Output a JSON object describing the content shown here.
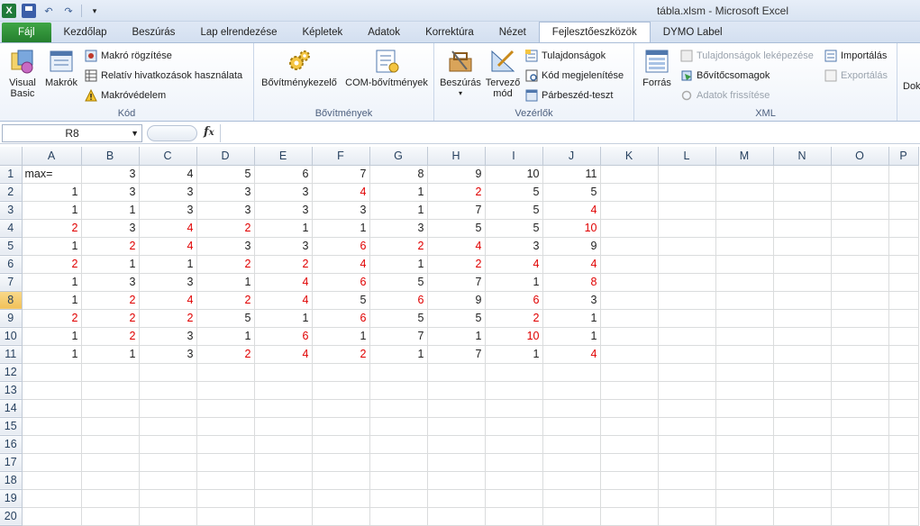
{
  "window": {
    "title": "tábla.xlsm  -  Microsoft Excel"
  },
  "tabs": [
    "Fájl",
    "Kezdőlap",
    "Beszúrás",
    "Lap elrendezése",
    "Képletek",
    "Adatok",
    "Korrektúra",
    "Nézet",
    "Fejlesztőeszközök",
    "DYMO Label"
  ],
  "active_tab": "Fejlesztőeszközök",
  "ribbon": {
    "kod": {
      "label": "Kód",
      "visual_basic": "Visual\nBasic",
      "makrok": "Makrók",
      "makro_rogzitese": "Makró rögzítése",
      "relativ": "Relatív hivatkozások használata",
      "makrovedelem": "Makróvédelem"
    },
    "bovitmenyek": {
      "label": "Bővítmények",
      "bovitmenykezelo": "Bővítménykezelő",
      "com": "COM-bővítmények"
    },
    "vezerlok": {
      "label": "Vezérlők",
      "beszuras": "Beszúrás",
      "tervezo": "Tervező\nmód",
      "tulajdonsagok": "Tulajdonságok",
      "kod_megjelenitese": "Kód megjelenítése",
      "parbeszed": "Párbeszéd-teszt"
    },
    "xml": {
      "label": "XML",
      "forras": "Forrás",
      "tulajdonsagok_lekepezese": "Tulajdonságok leképezése",
      "bovitocsomagok": "Bővítőcsomagok",
      "adatok_frissitese": "Adatok frissítése",
      "importalas": "Importálás",
      "exportalas": "Exportálás"
    },
    "extra": {
      "label": "Dok"
    }
  },
  "formula_bar": {
    "name_box": "R8",
    "fx": "fx",
    "formula": ""
  },
  "columns": [
    "A",
    "B",
    "C",
    "D",
    "E",
    "F",
    "G",
    "H",
    "I",
    "J",
    "K",
    "L",
    "M",
    "N",
    "O",
    "P"
  ],
  "selected_row": 8,
  "rows": [
    {
      "n": "1",
      "cells": [
        "max=",
        "3",
        "4",
        "5",
        "6",
        "7",
        "8",
        "9",
        "10",
        "11"
      ],
      "red": []
    },
    {
      "n": "2",
      "cells": [
        "1",
        "3",
        "3",
        "3",
        "3",
        "4",
        "1",
        "2",
        "5",
        "5"
      ],
      "red": [
        5,
        7
      ]
    },
    {
      "n": "3",
      "cells": [
        "1",
        "1",
        "3",
        "3",
        "3",
        "3",
        "1",
        "7",
        "5",
        "4"
      ],
      "red": [
        9
      ]
    },
    {
      "n": "4",
      "cells": [
        "2",
        "3",
        "4",
        "2",
        "1",
        "1",
        "3",
        "5",
        "5",
        "10"
      ],
      "red": [
        0,
        2,
        3,
        9
      ]
    },
    {
      "n": "5",
      "cells": [
        "1",
        "2",
        "4",
        "3",
        "3",
        "6",
        "2",
        "4",
        "3",
        "9"
      ],
      "red": [
        1,
        2,
        5,
        6,
        7
      ]
    },
    {
      "n": "6",
      "cells": [
        "2",
        "1",
        "1",
        "2",
        "2",
        "4",
        "1",
        "2",
        "4",
        "4"
      ],
      "red": [
        0,
        3,
        4,
        5,
        7,
        8,
        9
      ]
    },
    {
      "n": "7",
      "cells": [
        "1",
        "3",
        "3",
        "1",
        "4",
        "6",
        "5",
        "7",
        "1",
        "8"
      ],
      "red": [
        4,
        5,
        9
      ]
    },
    {
      "n": "8",
      "cells": [
        "1",
        "2",
        "4",
        "2",
        "4",
        "5",
        "6",
        "9",
        "6",
        "3"
      ],
      "red": [
        1,
        2,
        3,
        4,
        6,
        8
      ]
    },
    {
      "n": "9",
      "cells": [
        "2",
        "2",
        "2",
        "5",
        "1",
        "6",
        "5",
        "5",
        "2",
        "1"
      ],
      "red": [
        0,
        1,
        2,
        5,
        8
      ]
    },
    {
      "n": "10",
      "cells": [
        "1",
        "2",
        "3",
        "1",
        "6",
        "1",
        "7",
        "1",
        "10",
        "1"
      ],
      "red": [
        1,
        4,
        8
      ]
    },
    {
      "n": "11",
      "cells": [
        "1",
        "1",
        "3",
        "2",
        "4",
        "2",
        "1",
        "7",
        "1",
        "4"
      ],
      "red": [
        3,
        4,
        5,
        9
      ]
    },
    {
      "n": "12",
      "cells": [],
      "red": []
    },
    {
      "n": "13",
      "cells": [],
      "red": []
    },
    {
      "n": "14",
      "cells": [],
      "red": []
    },
    {
      "n": "15",
      "cells": [],
      "red": []
    },
    {
      "n": "16",
      "cells": [],
      "red": []
    },
    {
      "n": "17",
      "cells": [],
      "red": []
    },
    {
      "n": "18",
      "cells": [],
      "red": []
    },
    {
      "n": "19",
      "cells": [],
      "red": []
    },
    {
      "n": "20",
      "cells": [],
      "red": []
    }
  ],
  "colors": {
    "red_text": "#e00000",
    "file_tab": "#2e8f37",
    "selected_row_header": "#f5cc6e"
  }
}
